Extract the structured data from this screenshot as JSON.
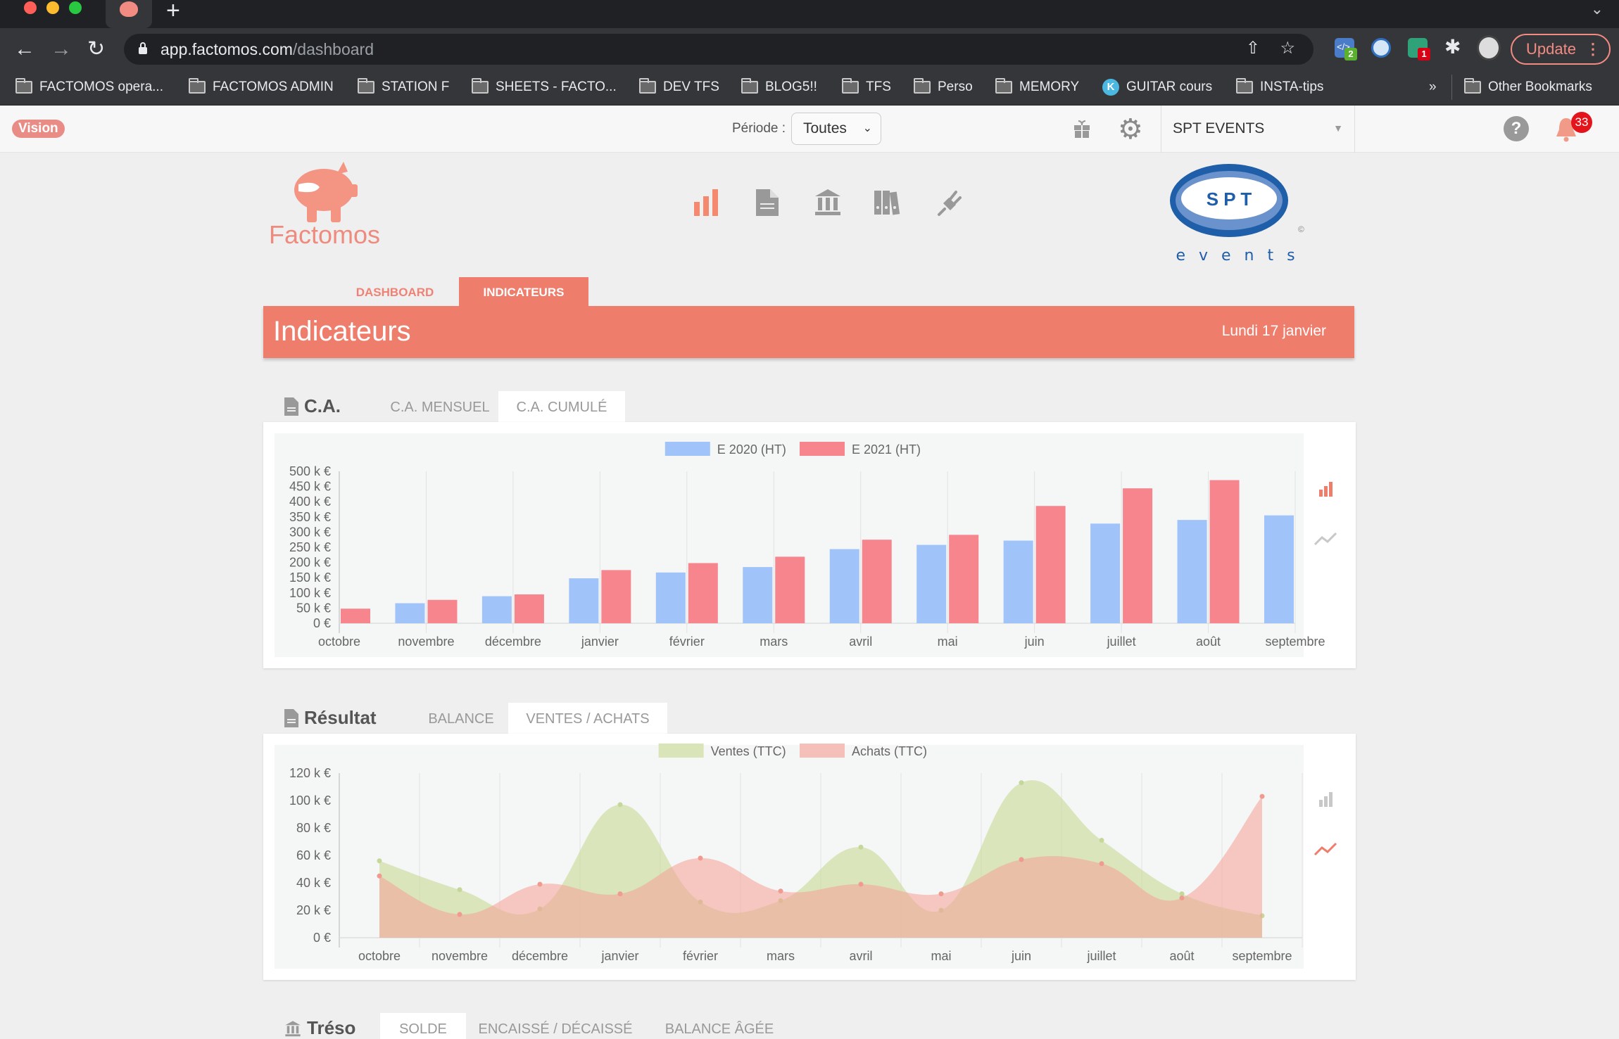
{
  "browser": {
    "tab_icon": "piggy-bank-icon",
    "url_host": "app.factomos.com",
    "url_path": "/dashboard",
    "extensions": [
      {
        "name": "code-extension",
        "badge": "2",
        "badge_color": "#5cb030"
      },
      {
        "name": "password-manager-extension"
      },
      {
        "name": "dialog-extension",
        "badge": "1",
        "badge_color": "#d70015"
      },
      {
        "name": "puzzle-extensions"
      }
    ],
    "update_label": "Update",
    "bookmarks": [
      {
        "label": "FACTOMOS opera...",
        "icon": "folder"
      },
      {
        "label": "FACTOMOS ADMIN",
        "icon": "folder"
      },
      {
        "label": "STATION F",
        "icon": "folder"
      },
      {
        "label": "SHEETS - FACTO...",
        "icon": "folder"
      },
      {
        "label": "DEV TFS",
        "icon": "folder"
      },
      {
        "label": "BLOG5!!",
        "icon": "folder"
      },
      {
        "label": "TFS",
        "icon": "folder"
      },
      {
        "label": "Perso",
        "icon": "folder"
      },
      {
        "label": "MEMORY",
        "icon": "folder"
      },
      {
        "label": "GUITAR cours",
        "icon": "k"
      },
      {
        "label": "INSTA-tips",
        "icon": "folder"
      }
    ],
    "overflow_label": "»",
    "other_bookmarks": "Other Bookmarks"
  },
  "topbar": {
    "badge": "Vision",
    "periode_label": "Période :",
    "periode_value": "Toutes",
    "company": "SPT EVENTS",
    "help": "?",
    "notifications_count": "33"
  },
  "brand": {
    "name": "Factomos",
    "client_logo_letters": "S P T",
    "client_logo_sub": "e v e n t s",
    "client_logo_copyright": "©"
  },
  "nav_icons": [
    "chart-bar-icon",
    "document-icon",
    "bank-icon",
    "binders-icon",
    "plug-icon"
  ],
  "page_tabs": [
    {
      "label": "DASHBOARD",
      "active": false
    },
    {
      "label": "INDICATEURS",
      "active": true
    }
  ],
  "header": {
    "title": "Indicateurs",
    "date": "Lundi 17 janvier"
  },
  "sections": {
    "ca": {
      "title": "C.A.",
      "tabs": [
        {
          "label": "C.A. MENSUEL",
          "active": false
        },
        {
          "label": "C.A. CUMULÉ",
          "active": true
        }
      ]
    },
    "resultat": {
      "title": "Résultat",
      "tabs": [
        {
          "label": "BALANCE",
          "active": false
        },
        {
          "label": "VENTES / ACHATS",
          "active": true
        }
      ]
    },
    "treso": {
      "title": "Tréso",
      "tabs": [
        {
          "label": "SOLDE",
          "active": true
        },
        {
          "label": "ENCAISSÉ / DÉCAISSÉ",
          "active": false
        },
        {
          "label": "BALANCE ÂGÉE",
          "active": false
        }
      ]
    }
  },
  "colors": {
    "accent": "#ef7d6c",
    "series_blue": "#a0c4fa",
    "series_red": "#f7858e",
    "ventes": "#d9e4b9",
    "achats": "#f5c0b9"
  },
  "chart_data": [
    {
      "type": "bar",
      "title": "",
      "categories": [
        "octobre",
        "novembre",
        "décembre",
        "janvier",
        "février",
        "mars",
        "avril",
        "mai",
        "juin",
        "juillet",
        "août",
        "septembre"
      ],
      "series": [
        {
          "name": "E 2020 (HT)",
          "color": "#a0c4fa",
          "values": [
            0,
            66,
            89,
            148,
            167,
            185,
            244,
            258,
            272,
            328,
            340,
            355
          ]
        },
        {
          "name": "E 2021 (HT)",
          "color": "#f7858e",
          "values": [
            48,
            77,
            95,
            175,
            198,
            219,
            275,
            291,
            386,
            444,
            471,
            null
          ]
        }
      ],
      "unit": "k €",
      "yticks": [
        "0 €",
        "50 k €",
        "100 k €",
        "150 k €",
        "200 k €",
        "250 k €",
        "300 k €",
        "350 k €",
        "400 k €",
        "450 k €",
        "500 k €"
      ],
      "ylim": [
        0,
        500
      ],
      "legend": "top-center",
      "grid": "vertical",
      "view_toggle": "bar"
    },
    {
      "type": "area",
      "title": "",
      "categories": [
        "octobre",
        "novembre",
        "décembre",
        "janvier",
        "février",
        "mars",
        "avril",
        "mai",
        "juin",
        "juillet",
        "août",
        "septembre"
      ],
      "series": [
        {
          "name": "Ventes (TTC)",
          "color": "#d9e4b9",
          "values": [
            56,
            35,
            21,
            97,
            26,
            27,
            66,
            20,
            113,
            71,
            32,
            16
          ]
        },
        {
          "name": "Achats (TTC)",
          "color": "#f5c0b9",
          "values": [
            45,
            17,
            39,
            32,
            58,
            34,
            39,
            32,
            57,
            54,
            29,
            103
          ]
        }
      ],
      "unit": "k €",
      "yticks": [
        "0 €",
        "20 k €",
        "40 k €",
        "60 k €",
        "80 k €",
        "100 k €",
        "120 k €"
      ],
      "ylim": [
        0,
        120
      ],
      "legend": "top-center",
      "grid": "vertical",
      "view_toggle": "line"
    }
  ]
}
